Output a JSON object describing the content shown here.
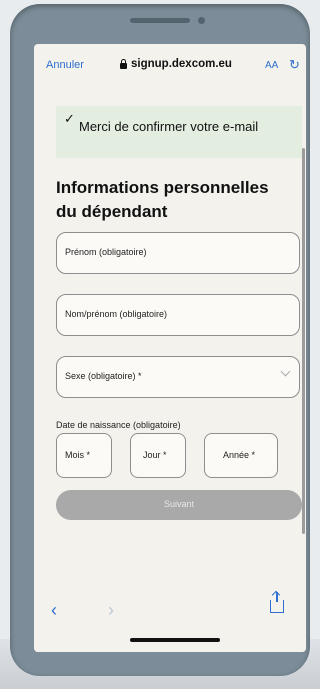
{
  "browser": {
    "cancel_label": "Annuler",
    "url": "signup.dexcom.eu",
    "text_size_label": "AA",
    "reload_icon": "reload-icon"
  },
  "banner": {
    "check_icon": "checkmark-icon",
    "text": "Merci de confirmer votre e-mail"
  },
  "form": {
    "title": "Informations personnelles du dépendant",
    "first_name_placeholder": "Prénom (obligatoire)",
    "last_name_placeholder": "Nom/prénom (obligatoire)",
    "sex_placeholder": "Sexe (obligatoire) *",
    "dob_label": "Date de naissance (obligatoire)",
    "dob_month": "Mois *",
    "dob_day": "Jour *",
    "dob_year": "Année *",
    "next_label": "Suivant"
  },
  "toolbar": {
    "back_icon": "back-arrow-icon",
    "forward_icon": "forward-arrow-icon",
    "share_icon": "share-icon"
  },
  "colors": {
    "accent": "#2f6fcf",
    "banner_bg": "#e3eee0",
    "button_disabled": "#a9a9a9"
  }
}
